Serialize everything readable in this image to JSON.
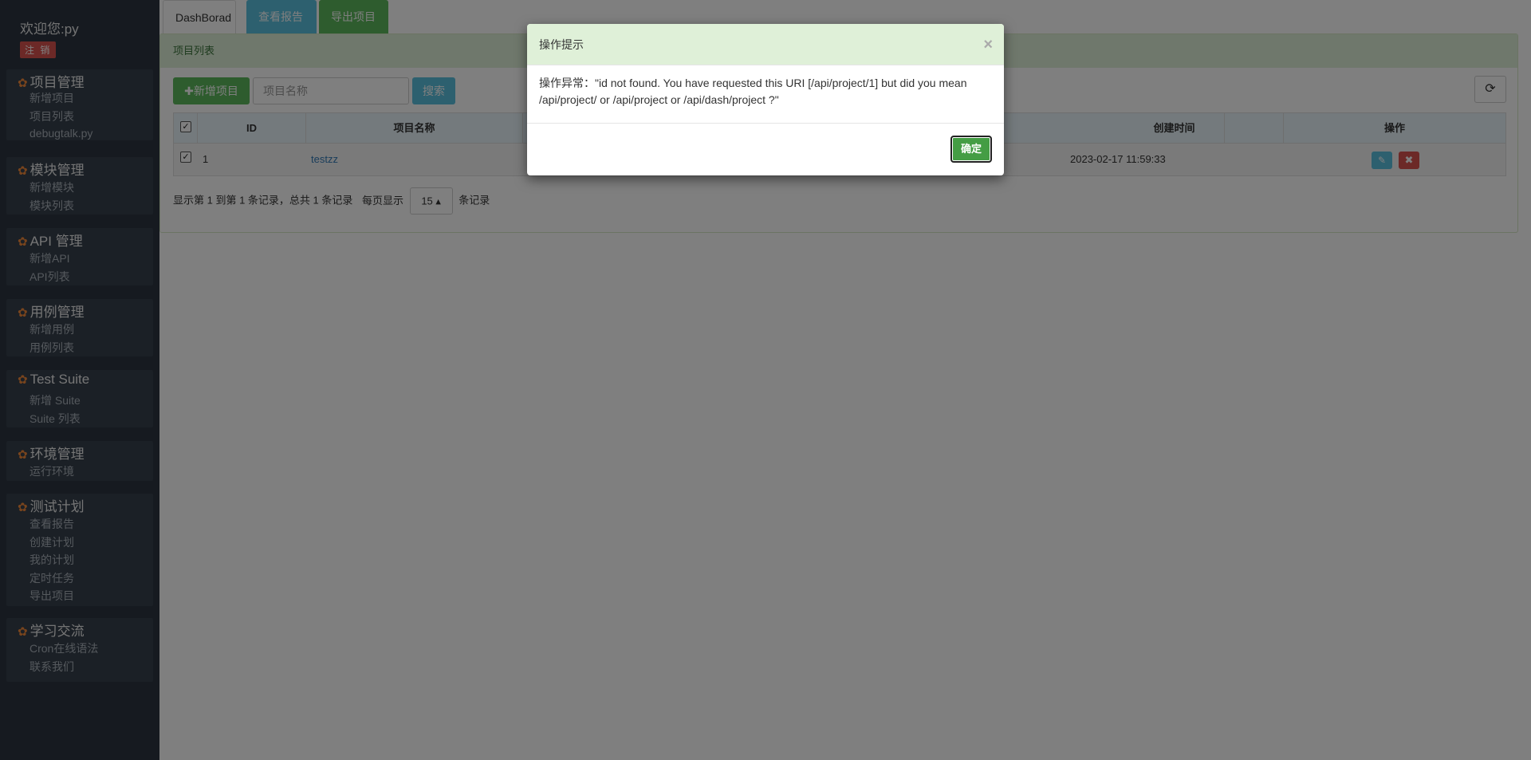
{
  "sidebar": {
    "welcome": "欢迎您:py",
    "logout": "注 销",
    "groups": [
      {
        "title": "项目管理",
        "items": [
          "新增项目",
          "项目列表",
          "debugtalk.py"
        ]
      },
      {
        "title": "模块管理",
        "items": [
          "新增模块",
          "模块列表"
        ]
      },
      {
        "title": "API 管理",
        "items": [
          "新增API",
          "API列表"
        ]
      },
      {
        "title": "用例管理",
        "items": [
          "新增用例",
          "用例列表"
        ]
      },
      {
        "title": "Test Suite",
        "items": [
          "新增 Suite",
          "Suite 列表"
        ]
      },
      {
        "title": "环境管理",
        "items": [
          "运行环境"
        ]
      },
      {
        "title": "测试计划",
        "items": [
          "查看报告",
          "创建计划",
          "我的计划",
          "定时任务",
          "导出项目"
        ]
      },
      {
        "title": "学习交流",
        "items": [
          "Cron在线语法",
          "联系我们"
        ]
      }
    ]
  },
  "tabs": {
    "dashboard": "DashBorad",
    "report": "查看报告",
    "export": "导出项目"
  },
  "panel": {
    "title": "项目列表",
    "add_button": "✚新增项目",
    "search_placeholder": "项目名称",
    "search_button": "搜索"
  },
  "table": {
    "headers": {
      "id": "ID",
      "name": "项目名称",
      "created": "创建时间",
      "actions": "操作"
    },
    "rows": [
      {
        "id": "1",
        "name": "testzz",
        "created": "2023-02-17 11:59:33"
      }
    ]
  },
  "pager": {
    "summary": "显示第 1 到第 1 条记录，总共 1 条记录",
    "per_page_prefix": "每页显示",
    "page_size": "15",
    "per_page_suffix": "条记录"
  },
  "modal": {
    "title": "操作提示",
    "close": "×",
    "message": "操作异常：\"id not found. You have requested this URI [/api/project/1] but did you mean /api/project/ or /api/project or /api/dash/project ?\"",
    "ok_button": "确定"
  }
}
